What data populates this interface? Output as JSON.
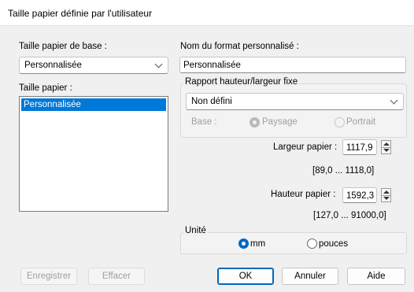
{
  "window": {
    "title": "Taille papier définie par l'utilisateur"
  },
  "left": {
    "base_size_label": "Taille papier de base :",
    "base_size_value": "Personnalisée",
    "paper_size_label": "Taille papier :",
    "paper_size_items": [
      "Personnalisée"
    ]
  },
  "right": {
    "custom_name_label": "Nom du format personnalisé :",
    "custom_name_value": "Personnalisée",
    "ratio_group_title": "Rapport hauteur/largeur fixe",
    "ratio_value": "Non défini",
    "base_label": "Base :",
    "landscape_label": "Paysage",
    "portrait_label": "Portrait",
    "width_label": "Largeur papier :",
    "width_value": "1117,9",
    "width_range": "[89,0 ... 1118,0]",
    "height_label": "Hauteur papier :",
    "height_value": "1592,3",
    "height_range": "[127,0 ... 91000,0]",
    "unit_group_title": "Unité",
    "unit_mm_label": "mm",
    "unit_inch_label": "pouces"
  },
  "buttons": {
    "save": "Enregistrer",
    "delete": "Effacer",
    "ok": "OK",
    "cancel": "Annuler",
    "help": "Aide"
  }
}
